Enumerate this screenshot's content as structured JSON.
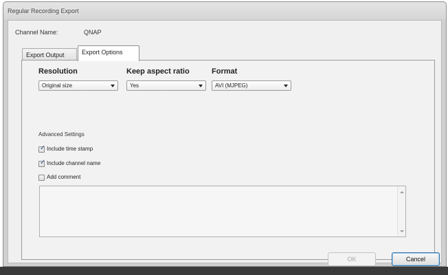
{
  "window": {
    "title": "Regular Recording Export"
  },
  "channel": {
    "label": "Channel Name:",
    "value": "QNAP"
  },
  "tabs": [
    {
      "label": "Export Output",
      "active": false
    },
    {
      "label": "Export Options",
      "active": true
    }
  ],
  "options": {
    "resolution": {
      "title": "Resolution",
      "value": "Original size"
    },
    "aspect": {
      "title": "Keep aspect ratio",
      "value": "Yes"
    },
    "format": {
      "title": "Format",
      "value": "AVI (MJPEG)"
    }
  },
  "advanced": {
    "title": "Advanced Settings",
    "checks": [
      {
        "label": "Include time stamp",
        "checked": true
      },
      {
        "label": "Include channel name",
        "checked": true
      },
      {
        "label": "Add comment",
        "checked": false
      }
    ],
    "comment_value": ""
  },
  "buttons": {
    "ok": "OK",
    "cancel": "Cancel",
    "ok_enabled": false
  }
}
